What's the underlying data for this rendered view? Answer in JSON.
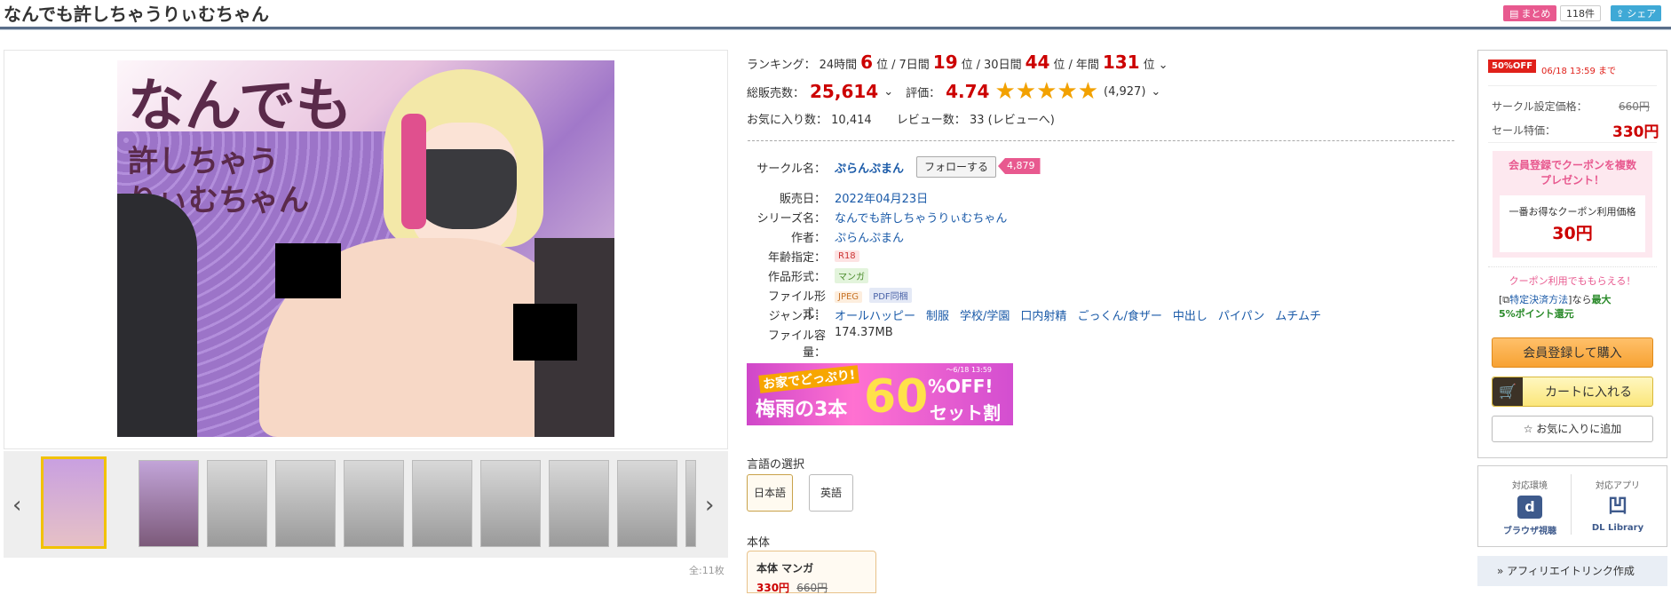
{
  "page": {
    "title": "なんでも許しちゃうりぃむちゃん"
  },
  "header": {
    "matome_label": "まとめ",
    "matome_count": "118件",
    "share_label": "シェア"
  },
  "cover": {
    "line1": "なんでも",
    "line2": "許しちゃう",
    "line3": "りぃむちゃん"
  },
  "gallery": {
    "total": "全:11枚",
    "prev_icon": "chevron-left-icon",
    "next_icon": "chevron-right-icon"
  },
  "ranking": {
    "label": "ランキング：",
    "h24_label": "24時間",
    "h24_value": "6",
    "h24_unit": "位",
    "d7_label": "7日間",
    "d7_value": "19",
    "d7_unit": "位",
    "d30_label": "30日間",
    "d30_value": "44",
    "d30_unit": "位",
    "year_label": "年間",
    "year_value": "131",
    "year_unit": "位",
    "sep": "/"
  },
  "sales": {
    "label": "総販売数：",
    "value": "25,614",
    "rating_label": "評価：",
    "rating_value": "4.74",
    "stars": "★★★★★",
    "rating_count": "(4,927)"
  },
  "stats": {
    "fav_label": "お気に入り数：",
    "fav_value": "10,414",
    "review_label": "レビュー数：",
    "review_value": "33",
    "review_link": "(レビューへ)"
  },
  "details": {
    "circle_label": "サークル名：",
    "circle_value": "ぷらんぷまん",
    "follow_label": "フォローする",
    "follow_count": "4,879",
    "release_label": "販売日：",
    "release_value": "2022年04月23日",
    "series_label": "シリーズ名：",
    "series_value": "なんでも許しちゃうりぃむちゃん",
    "author_label": "作者：",
    "author_value": "ぷらんぷまん",
    "age_label": "年齢指定：",
    "age_value": "R18",
    "format_label": "作品形式：",
    "format_value": "マンガ",
    "file_label": "ファイル形式：",
    "file_tag1": "JPEG",
    "file_tag2": "PDF同梱",
    "genre_label": "ジャンル：",
    "genres": [
      "オールハッピー",
      "制服",
      "学校/学園",
      "口内射精",
      "ごっくん/食ザー",
      "中出し",
      "パイパン",
      "ムチムチ"
    ],
    "size_label": "ファイル容量：",
    "size_value": "174.37MB"
  },
  "banner": {
    "date": "～6/18 13:59",
    "line1": "お家でどっぷり!",
    "line2": "梅雨の3本",
    "big": "60",
    "pct": "%OFF!",
    "set": "セット割"
  },
  "language": {
    "label": "言語の選択",
    "ja": "日本語",
    "en": "英語"
  },
  "edition": {
    "label": "本体",
    "name": "本体 マンガ",
    "price": "330円",
    "old_price": "660円"
  },
  "sidebar": {
    "sale_badge": "50%OFF",
    "sale_until": "06/18 13:59 まで",
    "set_price_label": "サークル設定価格：",
    "set_price": "660円",
    "sale_price_label": "セール特価：",
    "sale_price": "330円",
    "coupon_title1": "会員登録でクーポンを複数",
    "coupon_title2": "プレゼント！",
    "coupon_best_label": "一番お得なクーポン利用価格",
    "coupon_best_price": "30円",
    "coupon_note": "クーポン利用でももらえる！",
    "payment_pre": "[",
    "payment_link": "特定決済方法",
    "payment_mid": "]なら",
    "payment_bold": "最大",
    "payment_bold2": "5%ポイント還元",
    "register_buy": "会員登録して購入",
    "cart": "カートに入れる",
    "fav": "お気に入りに追加",
    "env_label": "対応環境",
    "app_label": "対応アプリ",
    "browser_label": "ブラウザ視聴",
    "dl_label": "DL Library",
    "affiliate": "» アフィリエイトリンク作成"
  },
  "colors": {
    "accent_red": "#cc0000",
    "star": "#f2a100",
    "link": "#1a5aa8",
    "sale_pink": "#e8598f"
  }
}
